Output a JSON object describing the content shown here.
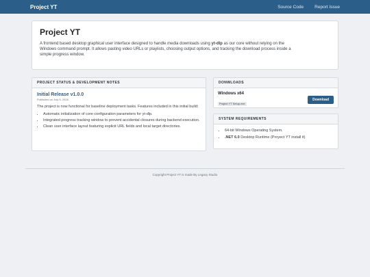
{
  "topbar": {
    "brand": "Project YT",
    "links": [
      "Source Code",
      "Report Issue"
    ]
  },
  "hero": {
    "title": "Project YT",
    "desc_pre": "A frontend based desktop graphical user interface designed to handle media downloads using ",
    "desc_bold": "yt-dlp",
    "desc_post": " as our core without relying on the Windows command prompt. It allows pasting video URLs or playlists, choosing output options, and tracking the download process inside a simple progress window."
  },
  "status": {
    "header": "PROJECT STATUS & DEVELOPMENT NOTES",
    "release_title": "Initial Release v1.0.0",
    "release_date": "Published on July 5, 2026",
    "description": "The project is now functional for baseline deployment tasks. Features included in this initial build:",
    "features": [
      "Automatic initialization of core configuration parameters for yt-dlp.",
      "Integrated progress tracking window to prevent accidental closures during backend execution.",
      "Clean user interface layout featuring explicit URL fields and local target directories."
    ]
  },
  "downloads": {
    "header": "DONWLOADS",
    "item_name": "Windows x64",
    "item_file": "Project YT Setup.exe",
    "button_label": "Download"
  },
  "requirements": {
    "header": "SYSTEM REQUIREMENTS",
    "item1": "64-bit Windows Operating System.",
    "item2_bold": ".NET 6.0",
    "item2_rest": " Desktop Runtime (Proyect YT install it)"
  },
  "footer": {
    "text": "Copyright Project YT is made By Legacy Studio"
  },
  "colors": {
    "accent": "#2c5e8a",
    "background": "#eef0f3"
  }
}
